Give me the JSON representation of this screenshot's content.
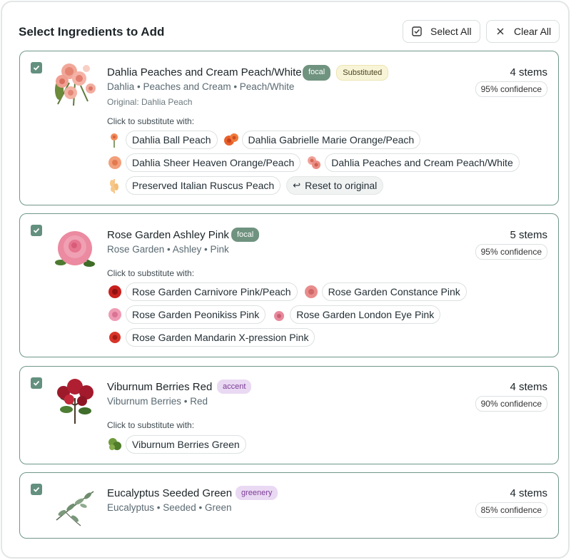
{
  "header": {
    "title": "Select Ingredients to Add",
    "select_all": "Select All",
    "clear_all": "Clear All"
  },
  "cards": [
    {
      "name": "Dahlia Peaches and Cream Peach/White",
      "badges": [
        "focal",
        "Substituted"
      ],
      "subline": "Dahlia • Peaches and Cream • Peach/White",
      "original": "Original: Dahlia Peach",
      "stems": "4 stems",
      "confidence": "95% confidence",
      "substitute_label": "Click to substitute with:",
      "substitutes": [
        "Dahlia Ball Peach",
        "Dahlia Gabrielle Marie Orange/Peach",
        "Dahlia Sheer Heaven Orange/Peach",
        "Dahlia Peaches and Cream Peach/White",
        "Preserved Italian Ruscus Peach"
      ],
      "reset_label": "Reset to original",
      "checked": true
    },
    {
      "name": "Rose Garden Ashley Pink",
      "badges": [
        "focal"
      ],
      "subline": "Rose Garden • Ashley • Pink",
      "stems": "5 stems",
      "confidence": "95% confidence",
      "substitute_label": "Click to substitute with:",
      "substitutes": [
        "Rose Garden Carnivore Pink/Peach",
        "Rose Garden Constance Pink",
        "Rose Garden Peonikiss Pink",
        "Rose Garden London Eye Pink",
        "Rose Garden Mandarin X-pression Pink"
      ],
      "checked": true
    },
    {
      "name": "Viburnum Berries Red",
      "badges": [
        "accent"
      ],
      "subline": "Viburnum Berries • Red",
      "stems": "4 stems",
      "confidence": "90% confidence",
      "substitute_label": "Click to substitute with:",
      "substitutes": [
        "Viburnum Berries Green"
      ],
      "checked": true
    },
    {
      "name": "Eucalyptus Seeded Green",
      "badges": [
        "greenery"
      ],
      "subline": "Eucalyptus • Seeded • Green",
      "stems": "4 stems",
      "confidence": "85% confidence",
      "checked": true
    }
  ],
  "colors": {
    "accent_green": "#6f937f",
    "card_border": "#6f978a",
    "substituted_bg": "#f8f4d7",
    "category_badge_bg": "#ead9f3"
  },
  "icons": {
    "select_all": "checkbox-icon",
    "clear_all": "close-icon",
    "reset": "undo-arrow-icon"
  }
}
